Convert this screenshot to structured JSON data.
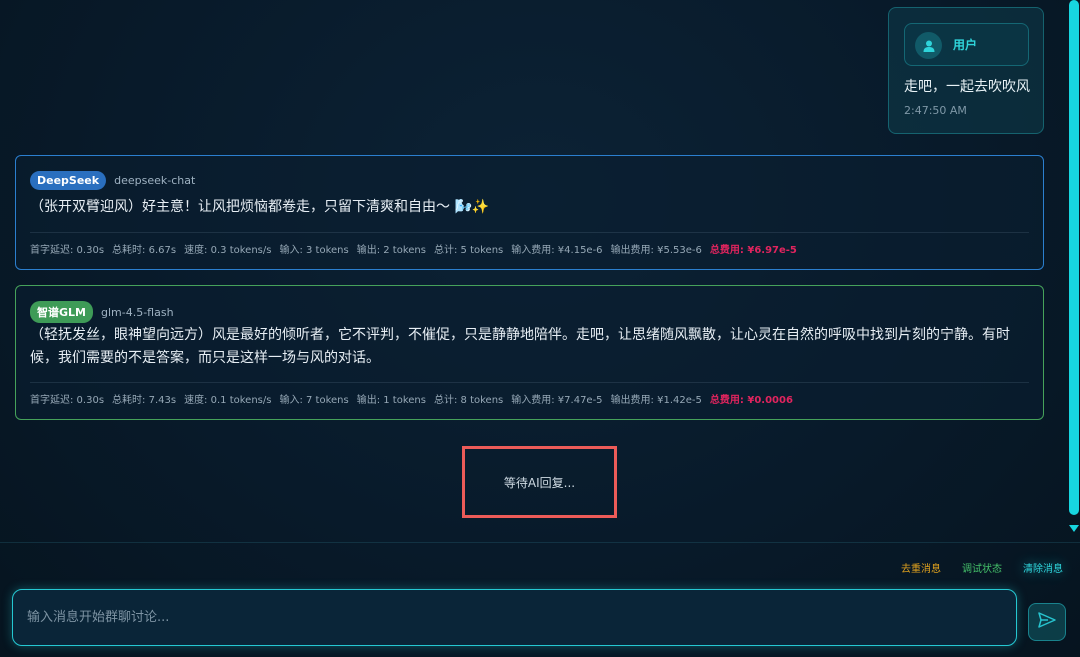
{
  "user_message": {
    "sender": "用户",
    "text": "走吧，一起去吹吹风",
    "time": "2:47:50 AM"
  },
  "ai_messages": [
    {
      "provider": "DeepSeek",
      "model": "deepseek-chat",
      "badge_color": "#2a6fbf",
      "border_color": "#2b7fcf",
      "text": "（张开双臂迎风）好主意！让风把烦恼都卷走，只留下清爽和自由～ 🌬️✨",
      "stats": {
        "ttft": "首字延迟: 0.30s",
        "total_time": "总耗时: 6.67s",
        "speed": "速度: 0.3 tokens/s",
        "input": "输入: 3 tokens",
        "output": "输出: 2 tokens",
        "total_tokens": "总计: 5 tokens",
        "input_cost": "输入费用: ¥4.15e-6",
        "output_cost": "输出费用: ¥5.53e-6",
        "total_cost": "总费用: ¥6.97e-5"
      }
    },
    {
      "provider": "智谱GLM",
      "model": "glm-4.5-flash",
      "badge_color": "#3e9b57",
      "border_color": "#46a25a",
      "text": "（轻抚发丝，眼神望向远方）风是最好的倾听者，它不评判，不催促，只是静静地陪伴。走吧，让思绪随风飘散，让心灵在自然的呼吸中找到片刻的宁静。有时候，我们需要的不是答案，而只是这样一场与风的对话。",
      "stats": {
        "ttft": "首字延迟: 0.30s",
        "total_time": "总耗时: 7.43s",
        "speed": "速度: 0.1 tokens/s",
        "input": "输入: 7 tokens",
        "output": "输出: 1 tokens",
        "total_tokens": "总计: 8 tokens",
        "input_cost": "输入费用: ¥7.47e-5",
        "output_cost": "输出费用: ¥1.42e-5",
        "total_cost": "总费用: ¥0.0006"
      }
    }
  ],
  "waiting_text": "等待AI回复...",
  "actions": {
    "dedupe": "去重消息",
    "debug": "调试状态",
    "clear": "清除消息"
  },
  "input": {
    "placeholder": "输入消息开始群聊讨论...",
    "value": ""
  },
  "icons": {
    "user": "user-icon",
    "send": "send-icon",
    "scroll": "scroll-down-icon"
  },
  "colors": {
    "accent": "#25c8d2",
    "total_cost": "#e0245e",
    "waiting_border": "#ec5b58"
  }
}
